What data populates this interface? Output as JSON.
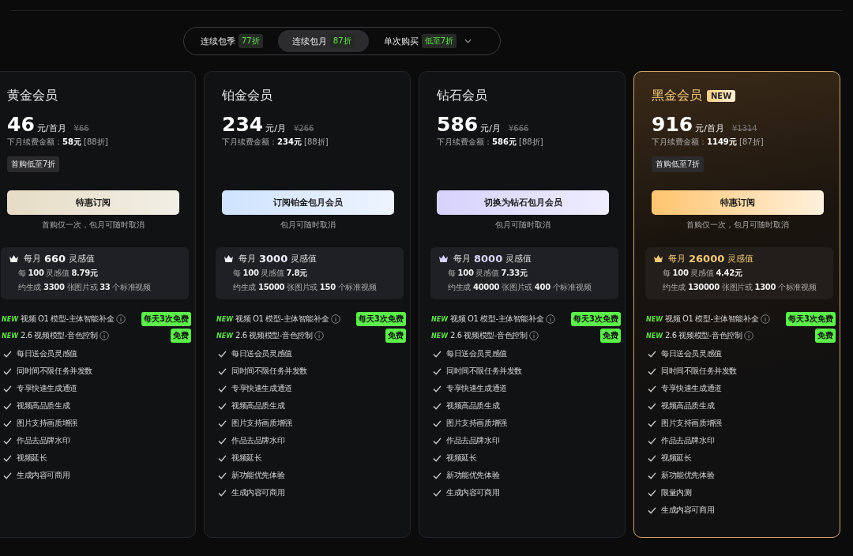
{
  "billing_tabs": [
    {
      "label": "连续包季",
      "discount": "77折",
      "selected": false
    },
    {
      "label": "连续包月",
      "discount": "87折",
      "selected": true
    },
    {
      "label": "单次购买",
      "discount": "低至7折",
      "selected": false,
      "dropdown": true
    }
  ],
  "plans": [
    {
      "kind": "gold",
      "name": "黄金会员",
      "color": "#f2f2f2",
      "price": "46",
      "unit": "元/首月",
      "original": "¥66",
      "renewal": "下月续费金额：**58元** [88折]",
      "promo": "首购低至7折",
      "button": "特惠订阅",
      "note": "首购仅一次，包月可随时取消",
      "credits_prefix": "每月",
      "credits": "660",
      "credits_suffix": "灵感值",
      "credit_lines": [
        "每 **100** 灵感值 **8.79元**",
        "约生成 **3300** 张图片或 **33** 个标准视频"
      ],
      "features": [
        {
          "kind": "new",
          "new_label": "NEW",
          "text": "视频 O1 模型-主体智能补全",
          "tag": "每天3次免费"
        },
        {
          "kind": "new",
          "new_label": "NEW",
          "text": "2.6 视频模型-音色控制",
          "tag": "免费"
        },
        {
          "kind": "check",
          "text": "每日送会员灵感值"
        },
        {
          "kind": "check",
          "text": "同时间不限任务并发数"
        },
        {
          "kind": "check",
          "text": "专享快速生成通道"
        },
        {
          "kind": "check",
          "text": "视频高品质生成"
        },
        {
          "kind": "check",
          "text": "图片支持画质增强"
        },
        {
          "kind": "check",
          "text": "作品去品牌水印"
        },
        {
          "kind": "check",
          "text": "视频延长"
        },
        {
          "kind": "check",
          "text": "生成内容可商用"
        }
      ]
    },
    {
      "kind": "platinum",
      "name": "铂金会员",
      "color": "#eef0ff",
      "price": "234",
      "unit": "元/月",
      "original": "¥266",
      "renewal": "下月续费金额：**234元** [88折]",
      "button": "订阅铂金包月会员",
      "note": "包月可随时取消",
      "credits_prefix": "每月",
      "credits": "3000",
      "credits_suffix": "灵感值",
      "credit_lines": [
        "每 **100** 灵感值 **7.8元**",
        "约生成 **15000** 张图片或 **150** 个标准视频"
      ],
      "features": [
        {
          "kind": "new",
          "new_label": "NEW",
          "text": "视频 O1 模型-主体智能补全",
          "tag": "每天3次免费"
        },
        {
          "kind": "new",
          "new_label": "NEW",
          "text": "2.6 视频模型-音色控制",
          "tag": "免费"
        },
        {
          "kind": "check",
          "text": "每日送会员灵感值"
        },
        {
          "kind": "check",
          "text": "同时间不限任务并发数"
        },
        {
          "kind": "check",
          "text": "专享快速生成通道"
        },
        {
          "kind": "check",
          "text": "视频高品质生成"
        },
        {
          "kind": "check",
          "text": "图片支持画质增强"
        },
        {
          "kind": "check",
          "text": "作品去品牌水印"
        },
        {
          "kind": "check",
          "text": "视频延长"
        },
        {
          "kind": "check",
          "text": "新功能优先体验"
        },
        {
          "kind": "check",
          "text": "生成内容可商用"
        }
      ]
    },
    {
      "kind": "diamond",
      "name": "钻石会员",
      "color": "#d9d4ff",
      "price": "586",
      "unit": "元/月",
      "original": "¥666",
      "renewal": "下月续费金额：**586元** [88折]",
      "button": "切换为钻石包月会员",
      "note": "包月可随时取消",
      "credits_prefix": "每月",
      "credits": "8000",
      "credits_suffix": "灵感值",
      "credit_lines": [
        "每 **100** 灵感值 **7.33元**",
        "约生成 **40000** 张图片或 **400** 个标准视频"
      ],
      "features": [
        {
          "kind": "new",
          "new_label": "NEW",
          "text": "视频 O1 模型-主体智能补全",
          "tag": "每天3次免费"
        },
        {
          "kind": "new",
          "new_label": "NEW",
          "text": "2.6 视频模型-音色控制",
          "tag": "免费"
        },
        {
          "kind": "check",
          "text": "每日送会员灵感值"
        },
        {
          "kind": "check",
          "text": "同时间不限任务并发数"
        },
        {
          "kind": "check",
          "text": "专享快速生成通道"
        },
        {
          "kind": "check",
          "text": "视频高品质生成"
        },
        {
          "kind": "check",
          "text": "图片支持画质增强"
        },
        {
          "kind": "check",
          "text": "作品去品牌水印"
        },
        {
          "kind": "check",
          "text": "视频延长"
        },
        {
          "kind": "check",
          "text": "新功能优先体验"
        },
        {
          "kind": "check",
          "text": "生成内容可商用"
        }
      ]
    },
    {
      "kind": "black_gold",
      "name": "黑金会员",
      "tag": "NEW",
      "color": "#f5c878",
      "price": "916",
      "unit": "元/首月",
      "original": "¥1314",
      "renewal": "下月续费金额：**1149元** [87折]",
      "promo": "首购低至7折",
      "button": "特惠订阅",
      "note": "首购仅一次，包月可随时取消",
      "credits_prefix": "每月",
      "credits": "26000",
      "credits_suffix": "灵感值",
      "credit_lines": [
        "每 **100** 灵感值 **4.42元**",
        "约生成 **130000** 张图片或 **1300** 个标准视频"
      ],
      "features": [
        {
          "kind": "new",
          "new_label": "NEW",
          "text": "视频 O1 模型-主体智能补全",
          "tag": "每天3次免费"
        },
        {
          "kind": "new",
          "new_label": "NEW",
          "text": "2.6 视频模型-音色控制",
          "tag": "免费"
        },
        {
          "kind": "check",
          "text": "每日送会员灵感值"
        },
        {
          "kind": "check",
          "text": "同时间不限任务并发数"
        },
        {
          "kind": "check",
          "text": "专享快速生成通道"
        },
        {
          "kind": "check",
          "text": "视频高品质生成"
        },
        {
          "kind": "check",
          "text": "图片支持画质增强"
        },
        {
          "kind": "check",
          "text": "作品去品牌水印"
        },
        {
          "kind": "check",
          "text": "视频延长"
        },
        {
          "kind": "check",
          "text": "新功能优先体验"
        },
        {
          "kind": "check",
          "text": "限量内测"
        },
        {
          "kind": "check",
          "text": "生成内容可商用"
        }
      ]
    }
  ]
}
